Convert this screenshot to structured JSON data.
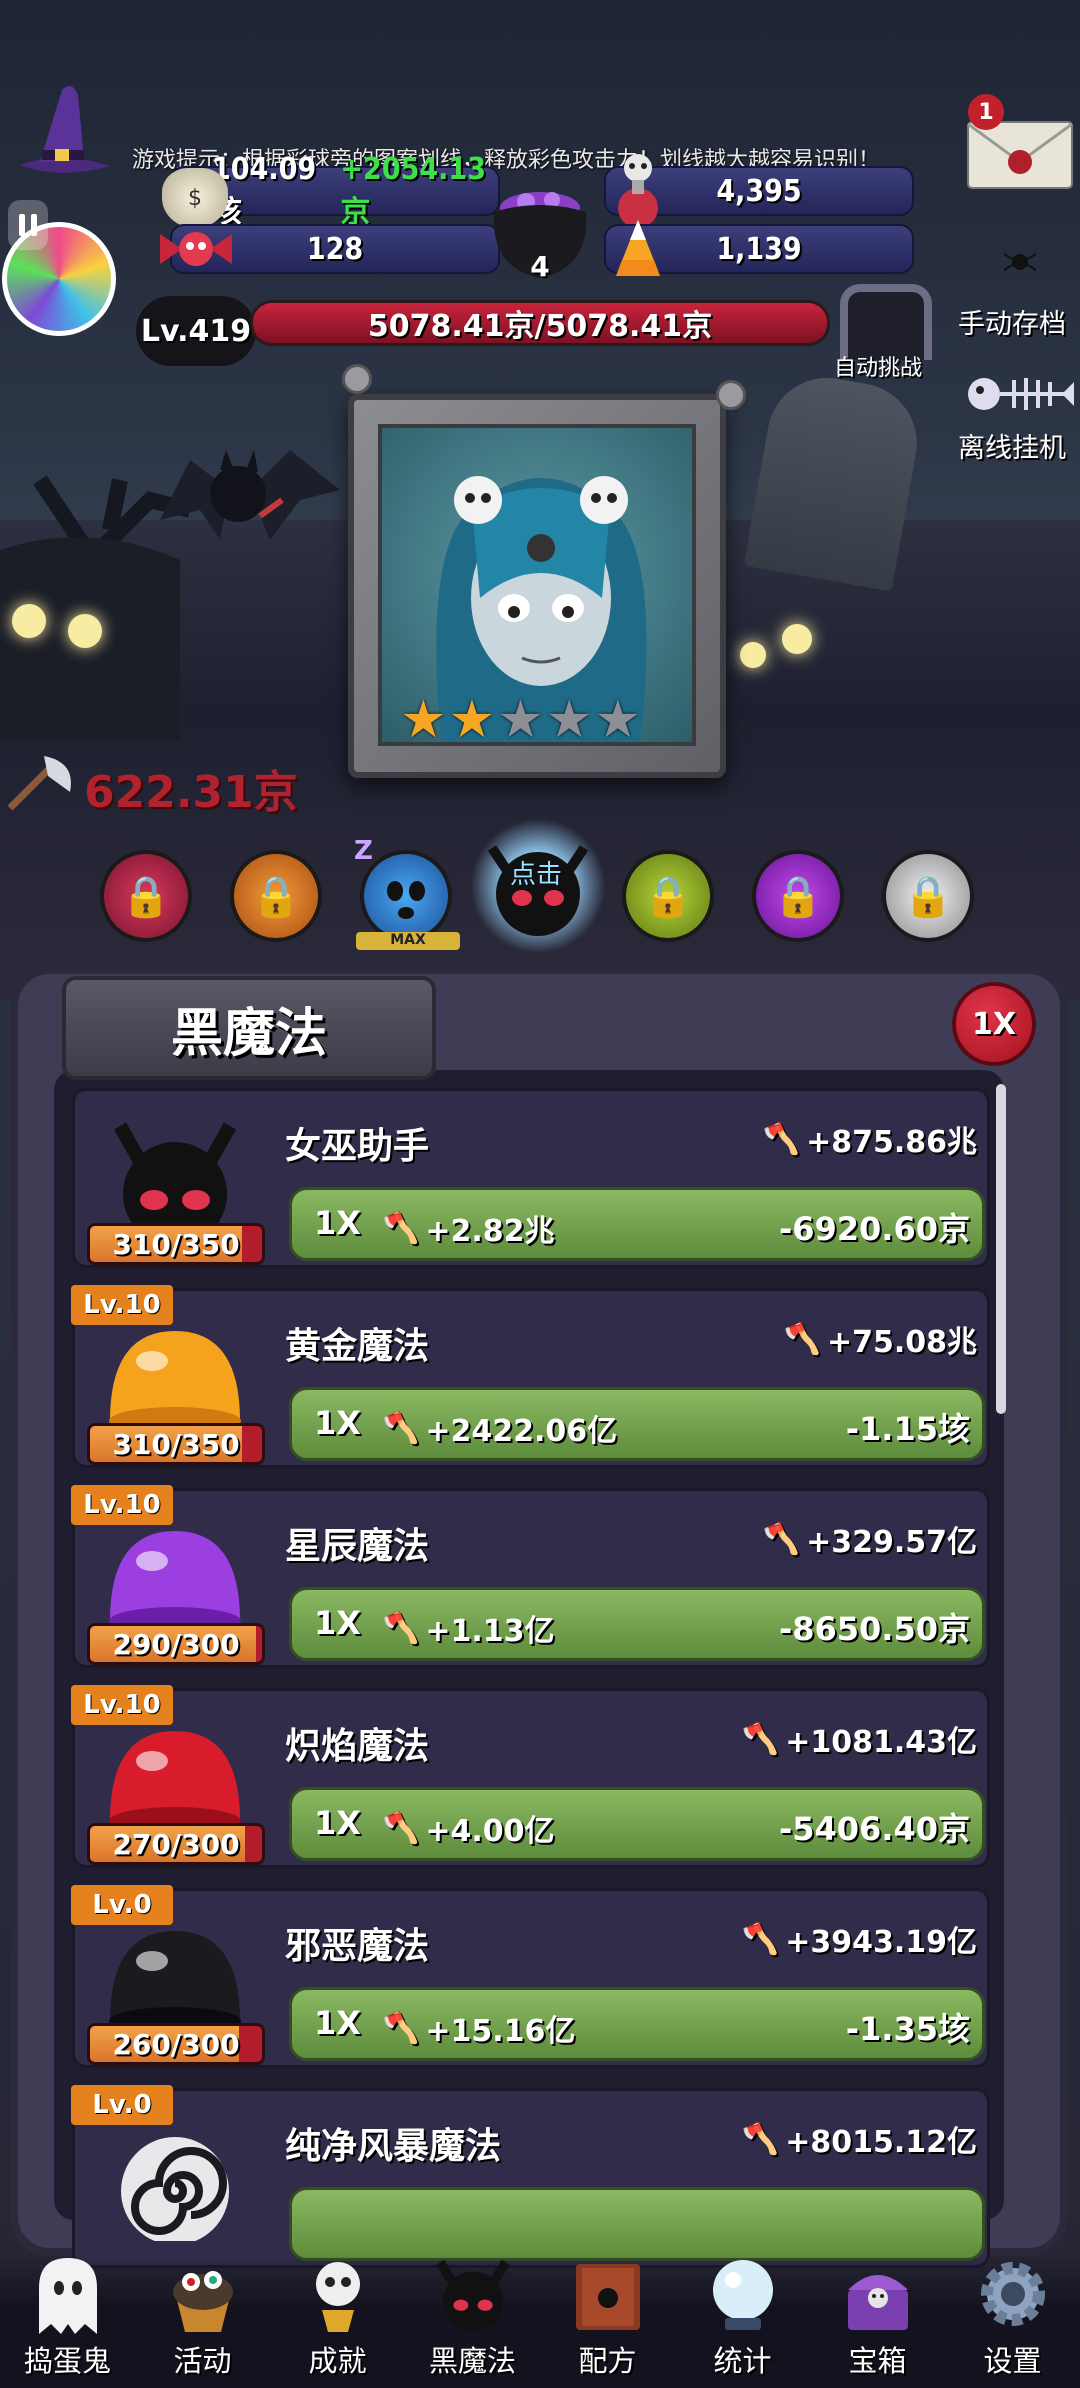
{
  "hud": {
    "hint": "游戏提示：根据彩球旁的图案划线，释放彩色攻击力！划线越大越容易识别！",
    "gold": "104.09垓",
    "gold_rate": "+2054.13京",
    "skull_count": "4,395",
    "candy_count": "128",
    "cauldron_count": "4",
    "corn_count": "1,139",
    "mail_badge": "1",
    "level": "Lv.419",
    "hp_text": "5078.41京/5078.41京",
    "hp_fraction": 1.0,
    "auto_challenge_label": "自动挑战",
    "manual_save_label": "手动存档",
    "offline_idle_label": "离线挂机"
  },
  "scene": {
    "stars_filled": 2,
    "stars_total": 5,
    "damage_float": "622.31京",
    "tap_hint": "点击",
    "max_label": "MAX",
    "sleep_label": "Z"
  },
  "panel": {
    "title": "黑魔法",
    "multiplier_badge": "1X",
    "items": [
      {
        "name": "女巫助手",
        "dps": "+875.86兆",
        "multiplier": "1X",
        "gain": "+2.82兆",
        "cost": "-6920.60京",
        "progress_text": "310/350",
        "progress": 0.886,
        "level_tag": "",
        "icon": "black-cat-icon"
      },
      {
        "name": "黄金魔法",
        "dps": "+75.08兆",
        "multiplier": "1X",
        "gain": "+2422.06亿",
        "cost": "-1.15垓",
        "progress_text": "310/350",
        "progress": 0.886,
        "level_tag": "Lv.10",
        "icon": "gold-jelly-icon"
      },
      {
        "name": "星辰魔法",
        "dps": "+329.57亿",
        "multiplier": "1X",
        "gain": "+1.13亿",
        "cost": "-8650.50京",
        "progress_text": "290/300",
        "progress": 0.967,
        "level_tag": "Lv.10",
        "icon": "purple-jelly-icon"
      },
      {
        "name": "炽焰魔法",
        "dps": "+1081.43亿",
        "multiplier": "1X",
        "gain": "+4.00亿",
        "cost": "-5406.40京",
        "progress_text": "270/300",
        "progress": 0.9,
        "level_tag": "Lv.10",
        "icon": "red-jelly-icon"
      },
      {
        "name": "邪恶魔法",
        "dps": "+3943.19亿",
        "multiplier": "1X",
        "gain": "+15.16亿",
        "cost": "-1.35垓",
        "progress_text": "260/300",
        "progress": 0.867,
        "level_tag": "Lv.0",
        "icon": "black-jelly-icon"
      },
      {
        "name": "纯净风暴魔法",
        "dps": "+8015.12亿",
        "multiplier": "",
        "gain": "",
        "cost": "",
        "progress_text": "",
        "progress": 0,
        "level_tag": "Lv.0",
        "icon": "swirl-jelly-icon"
      }
    ]
  },
  "nav": {
    "items": [
      {
        "label": "捣蛋鬼",
        "icon": "ghost-icon"
      },
      {
        "label": "活动",
        "icon": "cupcake-icon"
      },
      {
        "label": "成就",
        "icon": "trophy-skull-icon"
      },
      {
        "label": "黑魔法",
        "icon": "black-cat-icon"
      },
      {
        "label": "配方",
        "icon": "spellbook-icon"
      },
      {
        "label": "统计",
        "icon": "crystal-ball-icon"
      },
      {
        "label": "宝箱",
        "icon": "treasure-chest-icon"
      },
      {
        "label": "设置",
        "icon": "gear-icon"
      }
    ]
  },
  "colors": {
    "gold_rate": "#3de04a",
    "damage": "#b0222e",
    "level_tag": "#e6821e",
    "button_green": "#7aa852"
  }
}
